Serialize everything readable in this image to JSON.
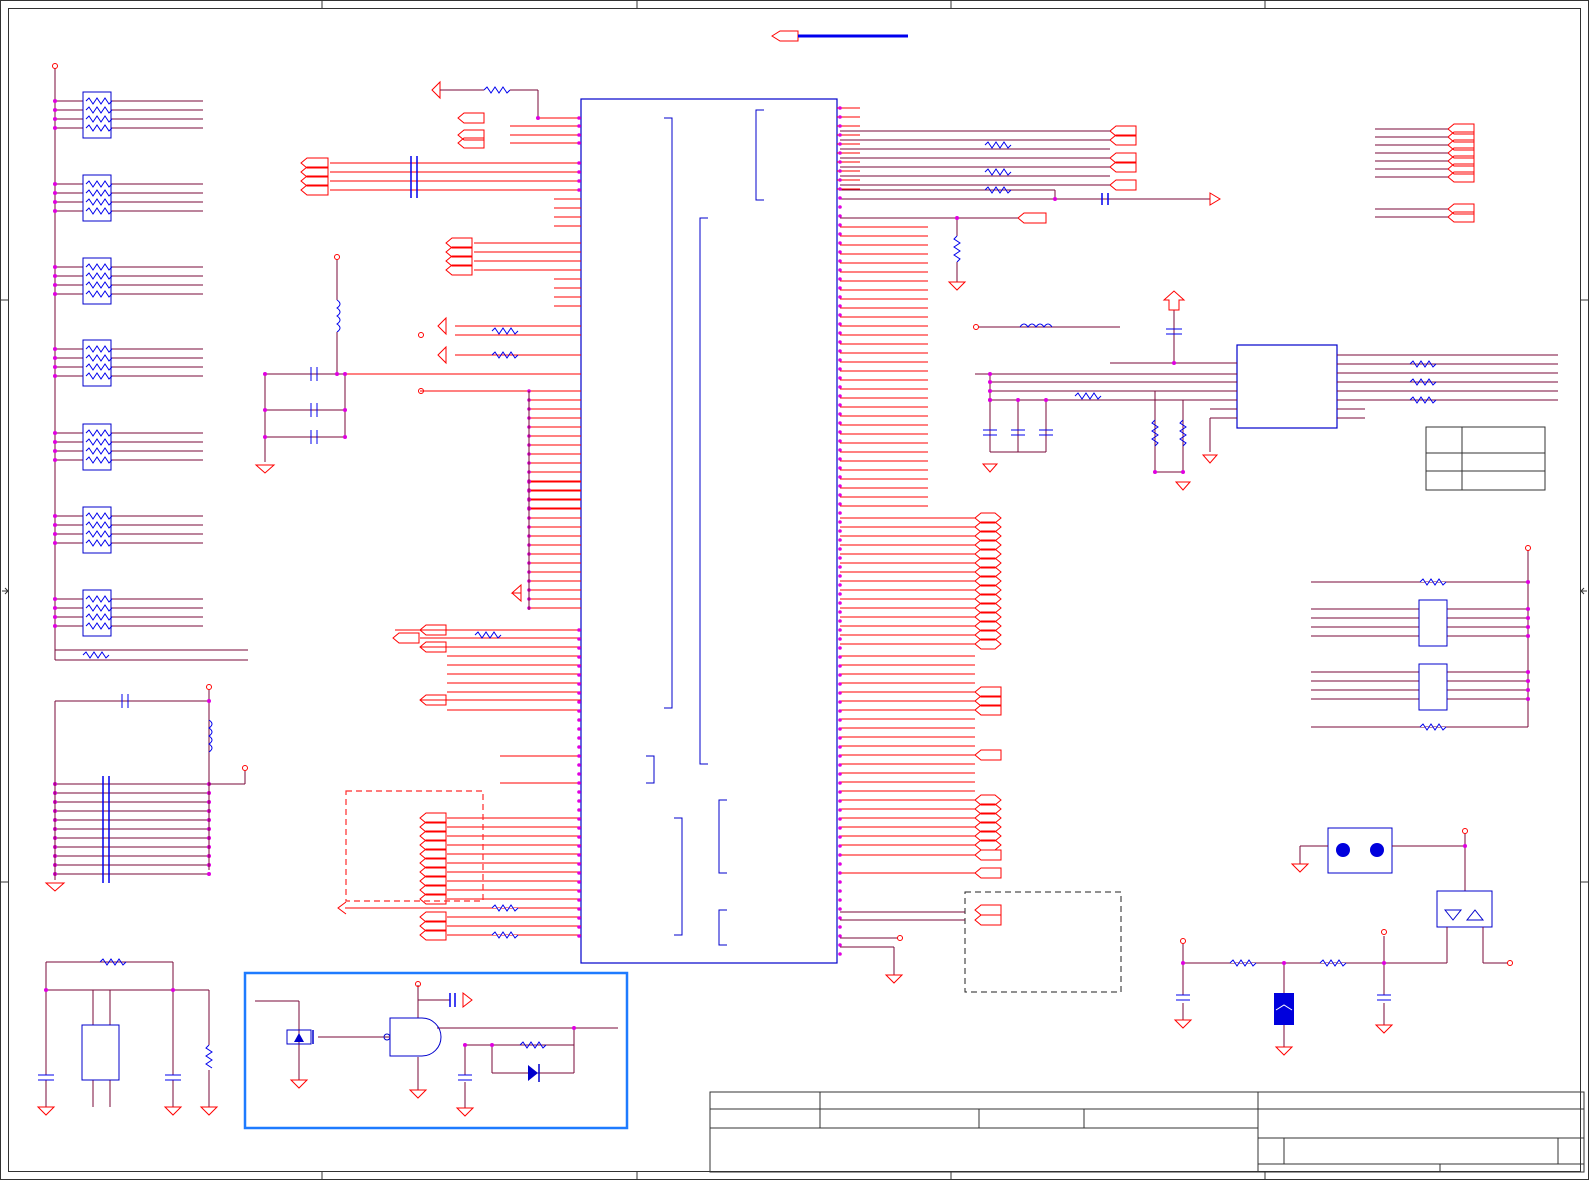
{
  "sheet": {
    "title": "",
    "rev": "",
    "date": "",
    "sheet_no": ""
  },
  "colors": {
    "border": "#333333",
    "wire": "#7a0a3a",
    "net": "#ff0000",
    "part": "#0000cc",
    "junction": "#e000e0",
    "highlight_box": "#1e7bff",
    "dashed_box": "#ff2a2a"
  },
  "components": [
    "main-ic",
    "resistor-networks",
    "decoupling-caps",
    "inductors",
    "crystal-oscillator",
    "ldo-regulator",
    "eeprom-ic",
    "reset-circuit",
    "connector-jumper",
    "mosfet",
    "led-indicator"
  ]
}
